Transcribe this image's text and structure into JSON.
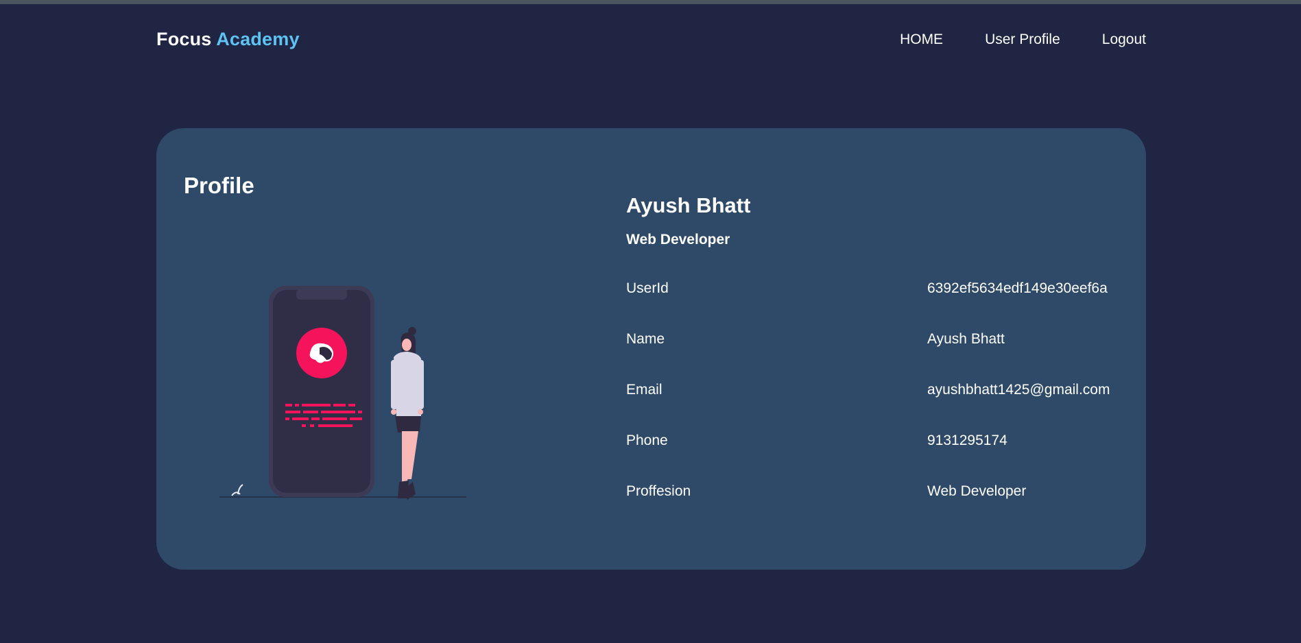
{
  "navbar": {
    "brand_first": "Focus",
    "brand_second": "Academy",
    "links": [
      {
        "label": "HOME"
      },
      {
        "label": "User Profile"
      },
      {
        "label": "Logout"
      }
    ]
  },
  "profile": {
    "title": "Profile",
    "name": "Ayush Bhatt",
    "role": "Web Developer",
    "fields": [
      {
        "label": "UserId",
        "value": "6392ef5634edf149e30eef6a"
      },
      {
        "label": "Name",
        "value": "Ayush Bhatt"
      },
      {
        "label": "Email",
        "value": "ayushbhatt1425@gmail.com"
      },
      {
        "label": "Phone",
        "value": "9131295174"
      },
      {
        "label": "Proffesion",
        "value": "Web Developer"
      }
    ]
  },
  "colors": {
    "background": "#1f2542",
    "card": "#2f4a68",
    "brand_accent": "#5ec2f2",
    "illustration_accent": "#f5135b"
  },
  "illustration": {
    "name": "phone-with-woman-illustration"
  }
}
